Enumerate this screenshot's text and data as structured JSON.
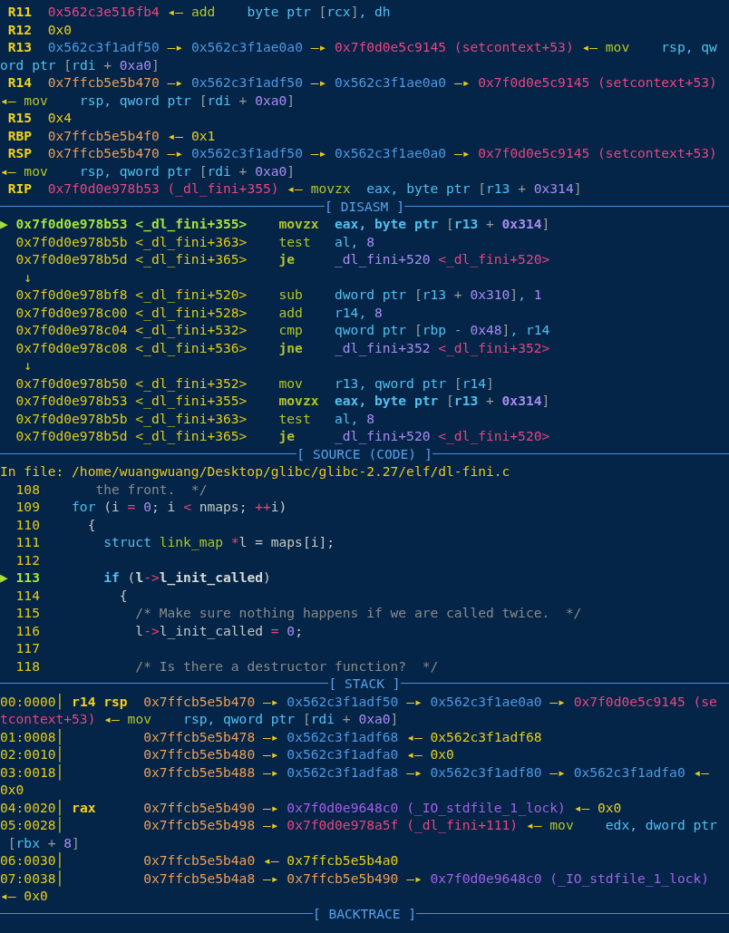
{
  "terminal": {
    "lines": [
      {
        "kind": "text",
        "segments": [
          {
            "text": " R11",
            "kind": "reg"
          },
          {
            "text": "  0x562c3e516fb4",
            "kind": "code"
          },
          {
            "text": " ◂— ",
            "kind": "arrow"
          },
          {
            "text": "add",
            "kind": "instr"
          },
          {
            "text": "    byte ptr ",
            "kind": "arg"
          },
          {
            "text": "[",
            "kind": "punct"
          },
          {
            "text": "rcx",
            "kind": "arg"
          },
          {
            "text": "]",
            "kind": "punct"
          },
          {
            "text": ", dh",
            "kind": "arg"
          }
        ]
      },
      {
        "kind": "text",
        "segments": [
          {
            "text": " R12",
            "kind": "reg"
          },
          {
            "text": "  0x0",
            "kind": "value"
          }
        ]
      },
      {
        "kind": "text",
        "segments": [
          {
            "text": " R13",
            "kind": "reg"
          },
          {
            "text": "  0x562c3f1adf50",
            "kind": "heap"
          },
          {
            "text": " —▸ ",
            "kind": "arrow"
          },
          {
            "text": "0x562c3f1ae0a0",
            "kind": "heap"
          },
          {
            "text": " —▸ ",
            "kind": "arrow"
          },
          {
            "text": "0x7f0d0e5c9145 (setcontext+53)",
            "kind": "code"
          },
          {
            "text": " ◂— ",
            "kind": "arrow"
          },
          {
            "text": "mov",
            "kind": "instr"
          },
          {
            "text": "    rsp, qw",
            "kind": "arg"
          }
        ]
      },
      {
        "kind": "text",
        "segments": [
          {
            "text": "ord ptr ",
            "kind": "arg"
          },
          {
            "text": "[",
            "kind": "punct"
          },
          {
            "text": "rdi",
            "kind": "arg"
          },
          {
            "text": " + ",
            "kind": "punct"
          },
          {
            "text": "0xa0",
            "kind": "num"
          },
          {
            "text": "]",
            "kind": "punct"
          }
        ]
      },
      {
        "kind": "text",
        "segments": [
          {
            "text": " R14",
            "kind": "reg"
          },
          {
            "text": "  0x7ffcb5e5b470",
            "kind": "stack"
          },
          {
            "text": " —▸ ",
            "kind": "arrow"
          },
          {
            "text": "0x562c3f1adf50",
            "kind": "heap"
          },
          {
            "text": " —▸ ",
            "kind": "arrow"
          },
          {
            "text": "0x562c3f1ae0a0",
            "kind": "heap"
          },
          {
            "text": " —▸ ",
            "kind": "arrow"
          },
          {
            "text": "0x7f0d0e5c9145 (setcontext+53)",
            "kind": "code"
          }
        ]
      },
      {
        "kind": "text",
        "segments": [
          {
            "text": "◂— ",
            "kind": "arrow"
          },
          {
            "text": "mov",
            "kind": "instr"
          },
          {
            "text": "    rsp, qword ptr ",
            "kind": "arg"
          },
          {
            "text": "[",
            "kind": "punct"
          },
          {
            "text": "rdi",
            "kind": "arg"
          },
          {
            "text": " + ",
            "kind": "punct"
          },
          {
            "text": "0xa0",
            "kind": "num"
          },
          {
            "text": "]",
            "kind": "punct"
          }
        ]
      },
      {
        "kind": "text",
        "segments": [
          {
            "text": " R15",
            "kind": "reg"
          },
          {
            "text": "  0x4",
            "kind": "value"
          }
        ]
      },
      {
        "kind": "text",
        "segments": [
          {
            "text": " RBP",
            "kind": "reg"
          },
          {
            "text": "  0x7ffcb5e5b4f0",
            "kind": "stack"
          },
          {
            "text": " ◂— ",
            "kind": "arrow"
          },
          {
            "text": "0x1",
            "kind": "value"
          }
        ]
      },
      {
        "kind": "text",
        "segments": [
          {
            "text": " RSP",
            "kind": "reg"
          },
          {
            "text": "  0x7ffcb5e5b470",
            "kind": "stack"
          },
          {
            "text": " —▸ ",
            "kind": "arrow"
          },
          {
            "text": "0x562c3f1adf50",
            "kind": "heap"
          },
          {
            "text": " —▸ ",
            "kind": "arrow"
          },
          {
            "text": "0x562c3f1ae0a0",
            "kind": "heap"
          },
          {
            "text": " —▸ ",
            "kind": "arrow"
          },
          {
            "text": "0x7f0d0e5c9145 (setcontext+53)",
            "kind": "code"
          }
        ]
      },
      {
        "kind": "text",
        "segments": [
          {
            "text": "◂— ",
            "kind": "arrow"
          },
          {
            "text": "mov",
            "kind": "instr"
          },
          {
            "text": "    rsp, qword ptr ",
            "kind": "arg"
          },
          {
            "text": "[",
            "kind": "punct"
          },
          {
            "text": "rdi",
            "kind": "arg"
          },
          {
            "text": " + ",
            "kind": "punct"
          },
          {
            "text": "0xa0",
            "kind": "num"
          },
          {
            "text": "]",
            "kind": "punct"
          }
        ]
      },
      {
        "kind": "text",
        "segments": [
          {
            "text": " RIP",
            "kind": "reg"
          },
          {
            "text": "  0x7f0d0e978b53 (_dl_fini+355)",
            "kind": "code"
          },
          {
            "text": " ◂— ",
            "kind": "arrow"
          },
          {
            "text": "movzx",
            "kind": "instr"
          },
          {
            "text": "  eax, byte ptr ",
            "kind": "arg"
          },
          {
            "text": "[",
            "kind": "punct"
          },
          {
            "text": "r13",
            "kind": "arg"
          },
          {
            "text": " + ",
            "kind": "punct"
          },
          {
            "text": "0x314",
            "kind": "num"
          },
          {
            "text": "]",
            "kind": "punct"
          }
        ]
      },
      {
        "kind": "header",
        "text": "[ DISASM ]"
      },
      {
        "kind": "text",
        "segments": [
          {
            "text": "▶ ",
            "kind": "marker"
          },
          {
            "text": "0x7f0d0e978b53 <_dl_fini+355>",
            "kind": "current"
          },
          {
            "text": "    movzx",
            "kind": "instr_bold"
          },
          {
            "text": "  eax, byte ptr ",
            "kind": "arg_bold"
          },
          {
            "text": "[",
            "kind": "punct"
          },
          {
            "text": "r13",
            "kind": "arg_bold"
          },
          {
            "text": " + ",
            "kind": "punct"
          },
          {
            "text": "0x314",
            "kind": "num_bold"
          },
          {
            "text": "]",
            "kind": "punct"
          }
        ]
      },
      {
        "kind": "text",
        "segments": [
          {
            "text": "  0x7f0d0e978b5b <_dl_fini+363>",
            "kind": "address"
          },
          {
            "text": "    test",
            "kind": "instr"
          },
          {
            "text": "   al, ",
            "kind": "arg"
          },
          {
            "text": "8",
            "kind": "num"
          }
        ]
      },
      {
        "kind": "text",
        "segments": [
          {
            "text": "  0x7f0d0e978b5d <_dl_fini+365>",
            "kind": "address"
          },
          {
            "text": "    je",
            "kind": "instr_bold"
          },
          {
            "text": "     _dl_fini+520",
            "kind": "num"
          },
          {
            "text": " <_dl_fini+520>",
            "kind": "code"
          }
        ]
      },
      {
        "kind": "text",
        "segments": [
          {
            "text": "   ↓",
            "kind": "address"
          }
        ]
      },
      {
        "kind": "text",
        "segments": [
          {
            "text": "  0x7f0d0e978bf8 <_dl_fini+520>",
            "kind": "address"
          },
          {
            "text": "    sub",
            "kind": "instr"
          },
          {
            "text": "    dword ptr ",
            "kind": "arg"
          },
          {
            "text": "[",
            "kind": "punct"
          },
          {
            "text": "r13",
            "kind": "arg"
          },
          {
            "text": " + ",
            "kind": "punct"
          },
          {
            "text": "0x310",
            "kind": "num"
          },
          {
            "text": "]",
            "kind": "punct"
          },
          {
            "text": ", ",
            "kind": "arg"
          },
          {
            "text": "1",
            "kind": "num"
          }
        ]
      },
      {
        "kind": "text",
        "segments": [
          {
            "text": "  0x7f0d0e978c00 <_dl_fini+528>",
            "kind": "address"
          },
          {
            "text": "    add",
            "kind": "instr"
          },
          {
            "text": "    r14, ",
            "kind": "arg"
          },
          {
            "text": "8",
            "kind": "num"
          }
        ]
      },
      {
        "kind": "text",
        "segments": [
          {
            "text": "  0x7f0d0e978c04 <_dl_fini+532>",
            "kind": "address"
          },
          {
            "text": "    cmp",
            "kind": "instr"
          },
          {
            "text": "    qword ptr ",
            "kind": "arg"
          },
          {
            "text": "[",
            "kind": "punct"
          },
          {
            "text": "rbp",
            "kind": "arg"
          },
          {
            "text": " - ",
            "kind": "punct"
          },
          {
            "text": "0x48",
            "kind": "num"
          },
          {
            "text": "]",
            "kind": "punct"
          },
          {
            "text": ", r14",
            "kind": "arg"
          }
        ]
      },
      {
        "kind": "text",
        "segments": [
          {
            "text": "  0x7f0d0e978c08 <_dl_fini+536>",
            "kind": "address"
          },
          {
            "text": "    jne",
            "kind": "instr_bold"
          },
          {
            "text": "    _dl_fini+352",
            "kind": "num"
          },
          {
            "text": " <_dl_fini+352>",
            "kind": "code"
          }
        ]
      },
      {
        "kind": "text",
        "segments": [
          {
            "text": "   ↓",
            "kind": "address"
          }
        ]
      },
      {
        "kind": "text",
        "segments": [
          {
            "text": "  0x7f0d0e978b50 <_dl_fini+352>",
            "kind": "address"
          },
          {
            "text": "    mov",
            "kind": "instr"
          },
          {
            "text": "    r13, qword ptr ",
            "kind": "arg"
          },
          {
            "text": "[",
            "kind": "punct"
          },
          {
            "text": "r14",
            "kind": "arg"
          },
          {
            "text": "]",
            "kind": "punct"
          }
        ]
      },
      {
        "kind": "text",
        "segments": [
          {
            "text": "  0x7f0d0e978b53 <_dl_fini+355>",
            "kind": "address"
          },
          {
            "text": "    movzx",
            "kind": "instr_bold"
          },
          {
            "text": "  eax, byte ptr ",
            "kind": "arg_bold"
          },
          {
            "text": "[",
            "kind": "punct"
          },
          {
            "text": "r13",
            "kind": "arg_bold"
          },
          {
            "text": " + ",
            "kind": "punct"
          },
          {
            "text": "0x314",
            "kind": "num_bold"
          },
          {
            "text": "]",
            "kind": "punct"
          }
        ]
      },
      {
        "kind": "text",
        "segments": [
          {
            "text": "  0x7f0d0e978b5b <_dl_fini+363>",
            "kind": "address"
          },
          {
            "text": "    test",
            "kind": "instr"
          },
          {
            "text": "   al, ",
            "kind": "arg"
          },
          {
            "text": "8",
            "kind": "num"
          }
        ]
      },
      {
        "kind": "text",
        "segments": [
          {
            "text": "  0x7f0d0e978b5d <_dl_fini+365>",
            "kind": "address"
          },
          {
            "text": "    je",
            "kind": "instr_bold"
          },
          {
            "text": "     _dl_fini+520",
            "kind": "num"
          },
          {
            "text": " <_dl_fini+520>",
            "kind": "code"
          }
        ]
      },
      {
        "kind": "header",
        "text": "[ SOURCE (CODE) ]"
      },
      {
        "kind": "text",
        "segments": [
          {
            "text": "In file: /home/wuangwuang/Desktop/glibc/glibc-2.27/elf/dl-fini.c",
            "kind": "file"
          }
        ]
      },
      {
        "kind": "text",
        "segments": [
          {
            "text": "  108",
            "kind": "lineno"
          },
          {
            "text": "       the front.  */",
            "kind": "comment"
          }
        ]
      },
      {
        "kind": "text",
        "segments": [
          {
            "text": "  109",
            "kind": "lineno"
          },
          {
            "text": "    for",
            "kind": "keyword"
          },
          {
            "text": " (i ",
            "kind": "plain"
          },
          {
            "text": "=",
            "kind": "op"
          },
          {
            "text": " 0",
            "kind": "num"
          },
          {
            "text": "; i ",
            "kind": "plain"
          },
          {
            "text": "<",
            "kind": "op"
          },
          {
            "text": " nmaps; ",
            "kind": "plain"
          },
          {
            "text": "++",
            "kind": "op"
          },
          {
            "text": "i)",
            "kind": "plain"
          }
        ]
      },
      {
        "kind": "text",
        "segments": [
          {
            "text": "  110",
            "kind": "lineno"
          },
          {
            "text": "      {",
            "kind": "plain"
          }
        ]
      },
      {
        "kind": "text",
        "segments": [
          {
            "text": "  111",
            "kind": "lineno"
          },
          {
            "text": "        struct",
            "kind": "keyword"
          },
          {
            "text": " link_map",
            "kind": "type"
          },
          {
            "text": " *",
            "kind": "op"
          },
          {
            "text": "l = maps[i];",
            "kind": "plain"
          }
        ]
      },
      {
        "kind": "text",
        "segments": [
          {
            "text": "  112",
            "kind": "lineno"
          }
        ]
      },
      {
        "kind": "text",
        "segments": [
          {
            "text": "▶ ",
            "kind": "marker"
          },
          {
            "text": "113",
            "kind": "current"
          },
          {
            "text": "        if",
            "kind": "keyword_bold"
          },
          {
            "text": " (",
            "kind": "plain"
          },
          {
            "text": "l",
            "kind": "plain_bold"
          },
          {
            "text": "->",
            "kind": "op"
          },
          {
            "text": "l_init_called",
            "kind": "plain_bold"
          },
          {
            "text": ")",
            "kind": "plain"
          }
        ]
      },
      {
        "kind": "text",
        "segments": [
          {
            "text": "  114",
            "kind": "lineno"
          },
          {
            "text": "          {",
            "kind": "plain"
          }
        ]
      },
      {
        "kind": "text",
        "segments": [
          {
            "text": "  115",
            "kind": "lineno"
          },
          {
            "text": "            /* Make sure nothing happens if we are called twice.  */",
            "kind": "comment"
          }
        ]
      },
      {
        "kind": "text",
        "segments": [
          {
            "text": "  116",
            "kind": "lineno"
          },
          {
            "text": "            l",
            "kind": "plain"
          },
          {
            "text": "->",
            "kind": "op"
          },
          {
            "text": "l_init_called ",
            "kind": "plain"
          },
          {
            "text": "=",
            "kind": "op"
          },
          {
            "text": " 0",
            "kind": "num"
          },
          {
            "text": ";",
            "kind": "plain"
          }
        ]
      },
      {
        "kind": "text",
        "segments": [
          {
            "text": "  117",
            "kind": "lineno"
          }
        ]
      },
      {
        "kind": "text",
        "segments": [
          {
            "text": "  118",
            "kind": "lineno"
          },
          {
            "text": "            /* Is there a destructor function?  */",
            "kind": "comment"
          }
        ]
      },
      {
        "kind": "header",
        "text": "[ STACK ]"
      },
      {
        "kind": "text",
        "segments": [
          {
            "text": "00:0000",
            "kind": "lineno"
          },
          {
            "text": "│",
            "kind": "separator"
          },
          {
            "text": " r14 rsp",
            "kind": "reg"
          },
          {
            "text": "  0x7ffcb5e5b470",
            "kind": "stack"
          },
          {
            "text": " —▸ ",
            "kind": "arrow"
          },
          {
            "text": "0x562c3f1adf50",
            "kind": "heap"
          },
          {
            "text": " —▸ ",
            "kind": "arrow"
          },
          {
            "text": "0x562c3f1ae0a0",
            "kind": "heap"
          },
          {
            "text": " —▸ ",
            "kind": "arrow"
          },
          {
            "text": "0x7f0d0e5c9145 (se",
            "kind": "code"
          }
        ]
      },
      {
        "kind": "text",
        "segments": [
          {
            "text": "tcontext+53)",
            "kind": "code"
          },
          {
            "text": " ◂— ",
            "kind": "arrow"
          },
          {
            "text": "mov",
            "kind": "instr"
          },
          {
            "text": "    rsp, qword ptr ",
            "kind": "arg"
          },
          {
            "text": "[",
            "kind": "punct"
          },
          {
            "text": "rdi",
            "kind": "arg"
          },
          {
            "text": " + ",
            "kind": "punct"
          },
          {
            "text": "0xa0",
            "kind": "num"
          },
          {
            "text": "]",
            "kind": "punct"
          }
        ]
      },
      {
        "kind": "text",
        "segments": [
          {
            "text": "01:0008",
            "kind": "lineno"
          },
          {
            "text": "│",
            "kind": "separator"
          },
          {
            "text": "          0x7ffcb5e5b478",
            "kind": "stack"
          },
          {
            "text": " —▸ ",
            "kind": "arrow"
          },
          {
            "text": "0x562c3f1adf68",
            "kind": "heap"
          },
          {
            "text": " ◂— ",
            "kind": "arrow"
          },
          {
            "text": "0x562c3f1adf68",
            "kind": "value"
          }
        ]
      },
      {
        "kind": "text",
        "segments": [
          {
            "text": "02:0010",
            "kind": "lineno"
          },
          {
            "text": "│",
            "kind": "separator"
          },
          {
            "text": "          0x7ffcb5e5b480",
            "kind": "stack"
          },
          {
            "text": " —▸ ",
            "kind": "arrow"
          },
          {
            "text": "0x562c3f1adfa0",
            "kind": "heap"
          },
          {
            "text": " ◂— ",
            "kind": "arrow"
          },
          {
            "text": "0x0",
            "kind": "value"
          }
        ]
      },
      {
        "kind": "text",
        "segments": [
          {
            "text": "03:0018",
            "kind": "lineno"
          },
          {
            "text": "│",
            "kind": "separator"
          },
          {
            "text": "          0x7ffcb5e5b488",
            "kind": "stack"
          },
          {
            "text": " —▸ ",
            "kind": "arrow"
          },
          {
            "text": "0x562c3f1adfa8",
            "kind": "heap"
          },
          {
            "text": " —▸ ",
            "kind": "arrow"
          },
          {
            "text": "0x562c3f1adf80",
            "kind": "heap"
          },
          {
            "text": " —▸ ",
            "kind": "arrow"
          },
          {
            "text": "0x562c3f1adfa0",
            "kind": "heap"
          },
          {
            "text": " ◂—",
            "kind": "arrow"
          }
        ]
      },
      {
        "kind": "text",
        "segments": [
          {
            "text": "0x0",
            "kind": "value"
          }
        ]
      },
      {
        "kind": "text",
        "segments": [
          {
            "text": "04:0020",
            "kind": "lineno"
          },
          {
            "text": "│",
            "kind": "separator"
          },
          {
            "text": " rax",
            "kind": "reg"
          },
          {
            "text": "      0x7ffcb5e5b490",
            "kind": "stack"
          },
          {
            "text": " —▸ ",
            "kind": "arrow"
          },
          {
            "text": "0x7f0d0e9648c0 (_IO_stdfile_1_lock)",
            "kind": "data"
          },
          {
            "text": " ◂— ",
            "kind": "arrow"
          },
          {
            "text": "0x0",
            "kind": "value"
          }
        ]
      },
      {
        "kind": "text",
        "segments": [
          {
            "text": "05:0028",
            "kind": "lineno"
          },
          {
            "text": "│",
            "kind": "separator"
          },
          {
            "text": "          0x7ffcb5e5b498",
            "kind": "stack"
          },
          {
            "text": " —▸ ",
            "kind": "arrow"
          },
          {
            "text": "0x7f0d0e978a5f (_dl_fini+111)",
            "kind": "code"
          },
          {
            "text": " ◂— ",
            "kind": "arrow"
          },
          {
            "text": "mov",
            "kind": "instr"
          },
          {
            "text": "    edx, dword ptr",
            "kind": "arg"
          }
        ]
      },
      {
        "kind": "text",
        "segments": [
          {
            "text": " [",
            "kind": "punct"
          },
          {
            "text": "rbx",
            "kind": "arg"
          },
          {
            "text": " + ",
            "kind": "punct"
          },
          {
            "text": "8",
            "kind": "num"
          },
          {
            "text": "]",
            "kind": "punct"
          }
        ]
      },
      {
        "kind": "text",
        "segments": [
          {
            "text": "06:0030",
            "kind": "lineno"
          },
          {
            "text": "│",
            "kind": "separator"
          },
          {
            "text": "          0x7ffcb5e5b4a0",
            "kind": "stack"
          },
          {
            "text": " ◂— ",
            "kind": "arrow"
          },
          {
            "text": "0x7ffcb5e5b4a0",
            "kind": "value"
          }
        ]
      },
      {
        "kind": "text",
        "segments": [
          {
            "text": "07:0038",
            "kind": "lineno"
          },
          {
            "text": "│",
            "kind": "separator"
          },
          {
            "text": "          0x7ffcb5e5b4a8",
            "kind": "stack"
          },
          {
            "text": " —▸ ",
            "kind": "arrow"
          },
          {
            "text": "0x7ffcb5e5b490",
            "kind": "stack"
          },
          {
            "text": " —▸ ",
            "kind": "arrow"
          },
          {
            "text": "0x7f0d0e9648c0 (_IO_stdfile_1_lock)",
            "kind": "data"
          }
        ]
      },
      {
        "kind": "text",
        "segments": [
          {
            "text": "◂— ",
            "kind": "arrow"
          },
          {
            "text": "0x0",
            "kind": "value"
          }
        ]
      },
      {
        "kind": "header",
        "text": "[ BACKTRACE ]"
      }
    ]
  }
}
